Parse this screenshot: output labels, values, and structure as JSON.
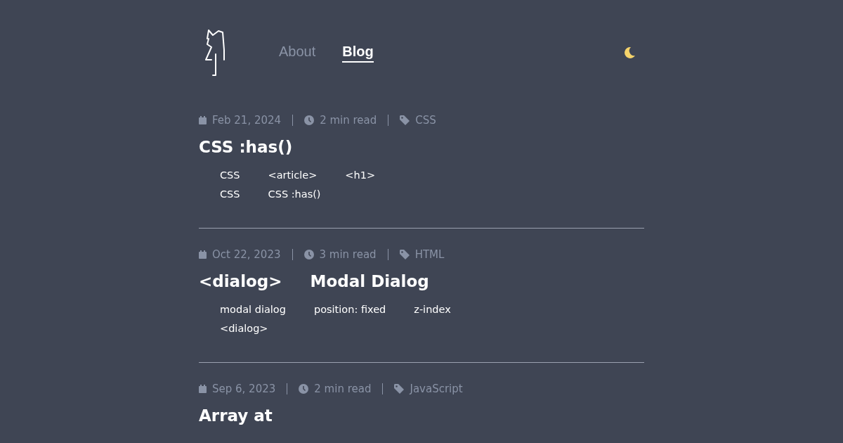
{
  "nav": [
    {
      "label": "About",
      "selected": false
    },
    {
      "label": "Blog",
      "selected": true
    }
  ],
  "posts": [
    {
      "date": "Feb 21, 2024",
      "read_time": "2 min read",
      "tag": "CSS",
      "title": [
        "CSS :has()"
      ],
      "summary": [
        [
          "CSS",
          "<article>",
          "<h1>"
        ],
        [
          "CSS",
          "CSS :has()"
        ]
      ]
    },
    {
      "date": "Oct 22, 2023",
      "read_time": "3 min read",
      "tag": "HTML",
      "title": [
        "<dialog>",
        "Modal Dialog"
      ],
      "summary": [
        [
          "modal dialog",
          "position: fixed",
          "z-index"
        ],
        [
          "<dialog>"
        ]
      ]
    },
    {
      "date": "Sep 6, 2023",
      "read_time": "2 min read",
      "tag": "JavaScript",
      "title": [
        "Array at"
      ]
    }
  ]
}
